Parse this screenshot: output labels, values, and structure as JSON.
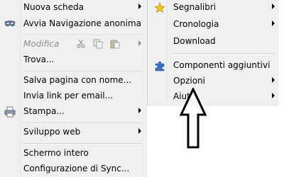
{
  "menu": {
    "items": [
      {
        "label": "Nuova scheda",
        "submenu": true
      },
      {
        "label": "Avvia Navigazione anonima",
        "icon": "mask-icon"
      },
      {
        "label": "Modifica",
        "disabled": true,
        "submenu": true
      },
      {
        "label": "Trova..."
      },
      {
        "label": "Salva pagina con nome..."
      },
      {
        "label": "Invia link per email..."
      },
      {
        "label": "Stampa...",
        "icon": "printer-icon",
        "submenu": true
      },
      {
        "label": "Sviluppo web",
        "submenu": true
      },
      {
        "label": "Schermo intero"
      },
      {
        "label": "Configurazione di Sync..."
      }
    ],
    "edit_icons": [
      "cut-icon",
      "copy-icon",
      "paste-icon"
    ]
  },
  "submenu": {
    "items": [
      {
        "label": "Segnalibri",
        "icon": "star-icon",
        "submenu": true
      },
      {
        "label": "Cronologia",
        "submenu": true
      },
      {
        "label": "Download"
      },
      {
        "label": "Componenti aggiuntivi",
        "icon": "puzzle-icon"
      },
      {
        "label": "Opzioni",
        "submenu": true
      },
      {
        "label": "Aiuto",
        "submenu": true
      }
    ]
  },
  "colors": {
    "menu_bg": "#f0f0f0",
    "star": "#f2c318",
    "puzzle": "#3a6fc4",
    "disabled_text": "#8d8d8d"
  }
}
